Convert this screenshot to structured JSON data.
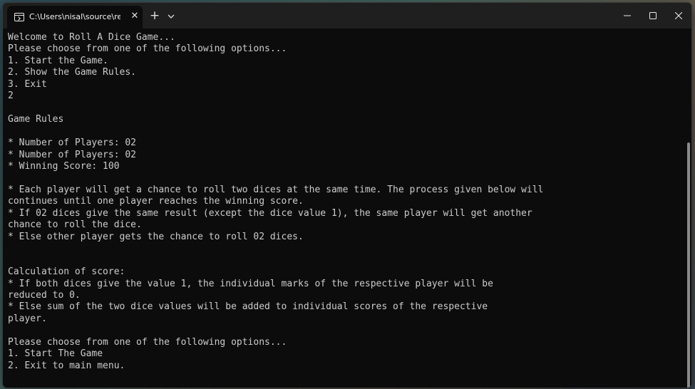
{
  "window": {
    "tab_title": "C:\\Users\\nisal\\source\\repos\\R",
    "tab_close_glyph": "✕",
    "new_tab_glyph": "+"
  },
  "console": {
    "lines": [
      "Welcome to Roll A Dice Game...",
      "Please choose from one of the following options...",
      "1. Start the Game.",
      "2. Show the Game Rules.",
      "3. Exit",
      "2",
      "",
      "Game Rules",
      "",
      "* Number of Players: 02",
      "* Number of Players: 02",
      "* Winning Score: 100",
      "",
      "* Each player will get a chance to roll two dices at the same time. The process given below will",
      "continues until one player reaches the winning score.",
      "* If 02 dices give the same result (except the dice value 1), the same player will get another",
      "chance to roll the dice.",
      "* Else other player gets the chance to roll 02 dices.",
      "",
      "",
      "Calculation of score:",
      "* If both dices give the value 1, the individual marks of the respective player will be",
      "reduced to 0.",
      "* Else sum of the two dice values will be added to individual scores of the respective",
      "player.",
      "",
      "Please choose from one of the following options...",
      "1. Start The Game",
      "2. Exit to main menu."
    ]
  },
  "icons": {
    "tab": "terminal-icon",
    "close_tab": "close-icon",
    "new_tab": "plus-icon",
    "dropdown": "chevron-down-icon",
    "minimize": "minimize-icon",
    "maximize": "maximize-icon",
    "close_window": "close-icon"
  }
}
